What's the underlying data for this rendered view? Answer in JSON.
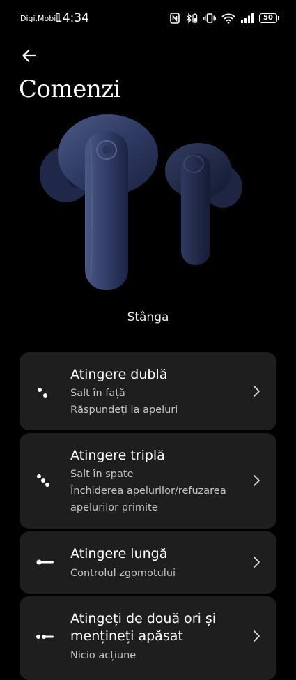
{
  "status_bar": {
    "carrier": "Digi.Mobil",
    "time": "14:34",
    "battery": "50",
    "icons": [
      "nfc-icon",
      "bluetooth-battery-icon",
      "vibrate-icon",
      "wifi-icon",
      "signal-icon",
      "battery-icon"
    ]
  },
  "header": {
    "back_icon": "arrow-left-icon",
    "title": "Comenzi"
  },
  "device": {
    "image": "earbuds-image",
    "side_label": "Stânga"
  },
  "gestures": [
    {
      "title": "Atingere dublă",
      "lines": [
        "Salt în față",
        "Răspundeți la apeluri"
      ],
      "icon": "double-tap-icon"
    },
    {
      "title": "Atingere triplă",
      "lines": [
        "Salt în spate",
        "Închiderea apelurilor/refuzarea",
        "apelurilor primite"
      ],
      "icon": "triple-tap-icon"
    },
    {
      "title": "Atingere lungă",
      "lines": [
        "Controlul zgomotului"
      ],
      "icon": "long-press-icon"
    },
    {
      "title_lines": [
        "Atingeți de două ori și",
        "mențineți apăsat"
      ],
      "lines": [
        "Nicio acțiune"
      ],
      "icon": "double-tap-hold-icon"
    }
  ]
}
